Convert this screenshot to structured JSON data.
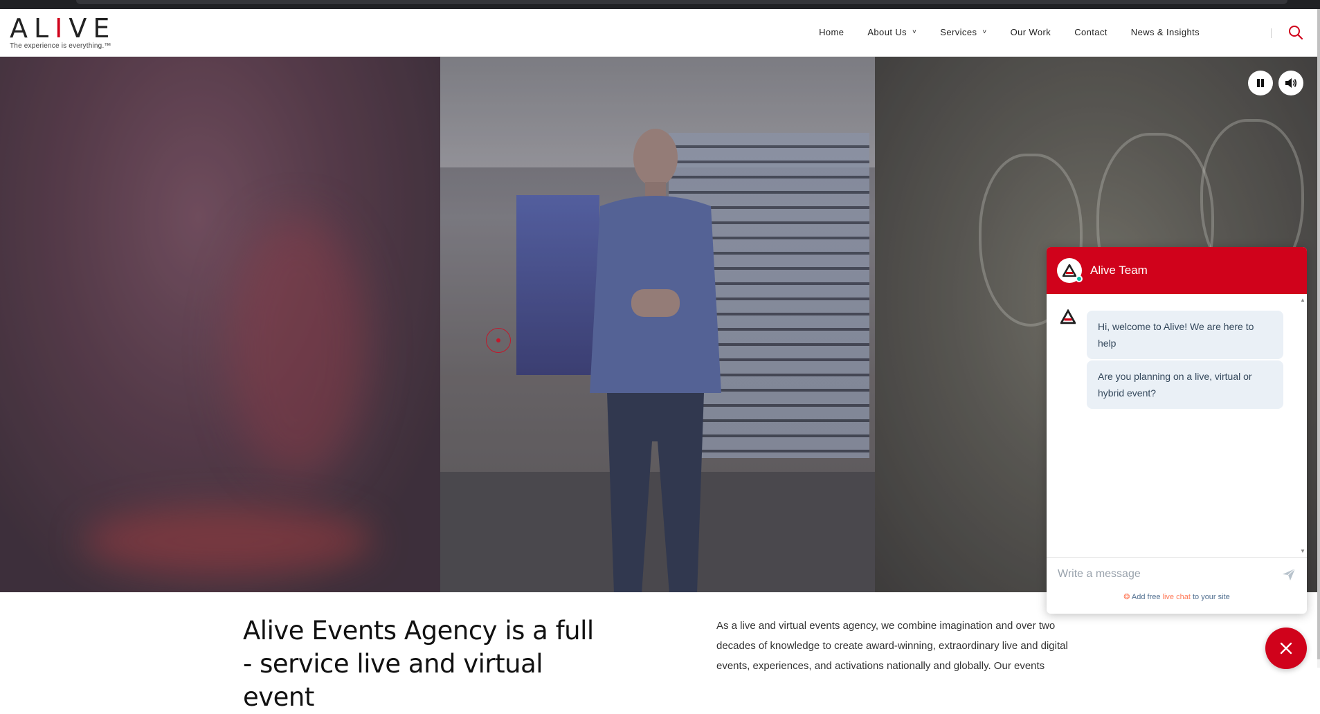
{
  "brand": {
    "logo_a": "AL",
    "logo_i": "I",
    "logo_ve": "VE",
    "tagline": "The experience is everything.™"
  },
  "nav": {
    "items": [
      {
        "label": "Home",
        "has_dropdown": false
      },
      {
        "label": "About Us",
        "has_dropdown": true
      },
      {
        "label": "Services",
        "has_dropdown": true
      },
      {
        "label": "Our Work",
        "has_dropdown": false
      },
      {
        "label": "Contact",
        "has_dropdown": false
      },
      {
        "label": "News & Insights",
        "has_dropdown": false
      }
    ],
    "search_icon": "search-icon"
  },
  "hero": {
    "controls": {
      "pause_icon": "pause-icon",
      "volume_icon": "volume-icon"
    }
  },
  "chat": {
    "header_title": "Alive Team",
    "messages": [
      "Hi, welcome to Alive! We are here to help",
      "Are you planning on a live, virtual or hybrid event?"
    ],
    "input_placeholder": "Write a message",
    "footer_prefix": "Add free ",
    "footer_highlight": "live chat",
    "footer_suffix": " to your site"
  },
  "intro": {
    "heading": "Alive Events Agency is a full - service live and virtual event",
    "text": "As a live and virtual events agency, we combine imagination and over two decades of knowledge to create award-winning, extraordinary live and digital events, experiences, and activations nationally and globally. Our events"
  },
  "colors": {
    "brand_red": "#d0021b",
    "chat_bubble": "#eaf0f6",
    "hubspot_orange": "#ff7a59"
  }
}
